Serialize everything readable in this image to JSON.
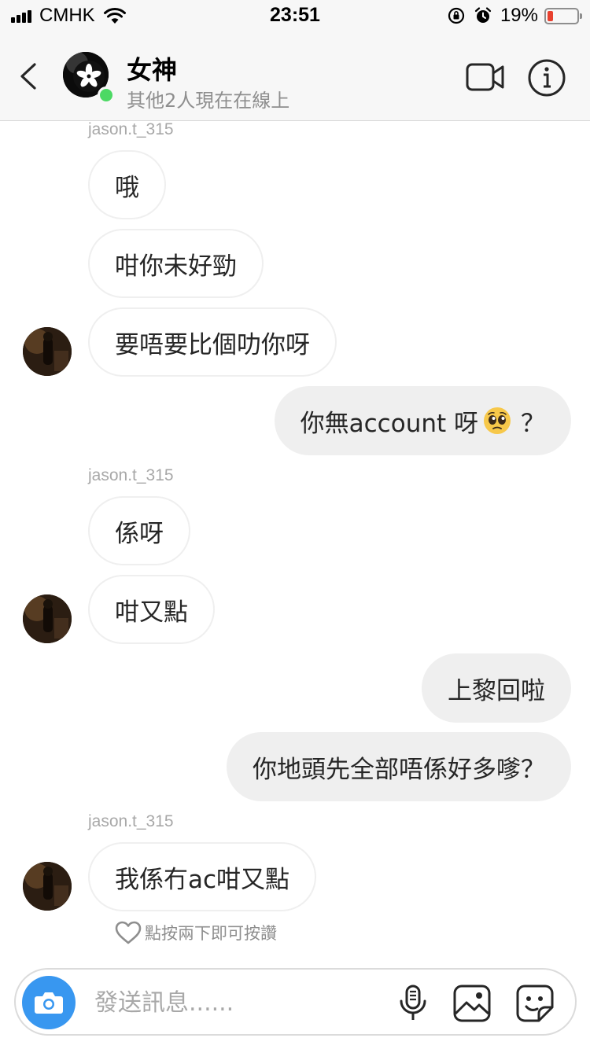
{
  "status_bar": {
    "carrier": "CMHK",
    "time": "23:51",
    "battery_percent": "19%",
    "battery_level": 0.19,
    "battery_color": "#e8412f"
  },
  "header": {
    "back_icon": "chevron-left-icon",
    "title": "女神",
    "subtitle": "其他2人現在在線上",
    "video_icon": "video-camera-icon",
    "info_icon": "info-icon"
  },
  "messages": [
    {
      "type": "sender",
      "text": "jason.t_315"
    },
    {
      "type": "in",
      "text": "哦"
    },
    {
      "type": "in",
      "text": "咁你未好勁"
    },
    {
      "type": "in",
      "text": "要唔要比個叻你呀"
    },
    {
      "type": "out",
      "text": "你無account 呀",
      "emoji": "pleading-face-emoji",
      "suffix": "？"
    },
    {
      "type": "sender",
      "text": "jason.t_315"
    },
    {
      "type": "in",
      "text": "係呀"
    },
    {
      "type": "in",
      "text": "咁又點"
    },
    {
      "type": "out",
      "text": "上黎回啦"
    },
    {
      "type": "out",
      "text": "你地頭先全部唔係好多嗲？"
    },
    {
      "type": "sender",
      "text": "jason.t_315"
    },
    {
      "type": "in",
      "text": "我係冇ac咁又點"
    }
  ],
  "like_hint": "點按兩下即可按讚",
  "composer": {
    "placeholder": "發送訊息......",
    "camera_icon": "camera-icon",
    "mic_icon": "microphone-icon",
    "gallery_icon": "gallery-icon",
    "sticker_icon": "sticker-icon"
  },
  "colors": {
    "accent": "#3897f0",
    "online": "#4cd964",
    "outgoing_bubble": "#efefef"
  }
}
